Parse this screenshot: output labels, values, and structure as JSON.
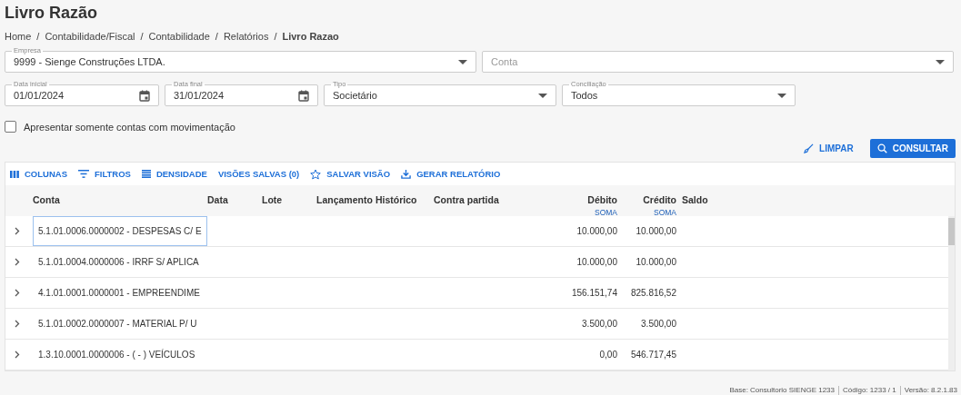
{
  "page_title": "Livro Razão",
  "breadcrumb": {
    "separator": "/",
    "items": [
      {
        "label": "Home",
        "current": false
      },
      {
        "label": "Contabilidade/Fiscal",
        "current": false
      },
      {
        "label": "Contabilidade",
        "current": false
      },
      {
        "label": "Relatórios",
        "current": false
      },
      {
        "label": "Livro Razao",
        "current": true
      }
    ]
  },
  "filters": {
    "empresa": {
      "label": "Empresa",
      "value": "9999 - Sienge Construções LTDA."
    },
    "conta": {
      "placeholder": "Conta"
    },
    "data_inicial": {
      "label": "Data inicial",
      "value": "01/01/2024"
    },
    "data_final": {
      "label": "Data final",
      "value": "31/01/2024"
    },
    "tipo": {
      "label": "Tipo",
      "value": "Societário"
    },
    "conciliacao": {
      "label": "Conciliação",
      "value": "Todos"
    },
    "only_moved": {
      "label": "Apresentar somente contas com movimentação",
      "checked": false
    }
  },
  "actions": {
    "clear": "LIMPAR",
    "search": "CONSULTAR"
  },
  "toolbar": [
    {
      "kind": "columns",
      "label": "COLUNAS"
    },
    {
      "kind": "filters",
      "label": "FILTROS"
    },
    {
      "kind": "density",
      "label": "DENSIDADE"
    },
    {
      "kind": "views",
      "label": "VISÕES SALVAS (0)"
    },
    {
      "kind": "save",
      "label": "SALVAR VISÃO"
    },
    {
      "kind": "export",
      "label": "GERAR RELATÓRIO"
    }
  ],
  "table": {
    "columns": [
      {
        "label": "Conta"
      },
      {
        "label": "Data"
      },
      {
        "label": "Lote"
      },
      {
        "label": "Lançamento"
      },
      {
        "label": "Histórico"
      },
      {
        "label": "Contra partida"
      },
      {
        "label": "Débito",
        "aggregate": "SOMA"
      },
      {
        "label": "Crédito",
        "aggregate": "SOMA"
      },
      {
        "label": "Saldo"
      }
    ],
    "rows": [
      {
        "conta": "5.1.01.0006.0000002 - DESPESAS C/ E",
        "debito": "10.000,00",
        "credito": "10.000,00",
        "selected": true
      },
      {
        "conta": "5.1.01.0004.0000006 - IRRF S/ APLICA",
        "debito": "10.000,00",
        "credito": "10.000,00",
        "selected": false
      },
      {
        "conta": "4.1.01.0001.0000001 - EMPREENDIME",
        "debito": "156.151,74",
        "credito": "825.816,52",
        "selected": false
      },
      {
        "conta": "5.1.01.0002.0000007 - MATERIAL P/ U",
        "debito": "3.500,00",
        "credito": "3.500,00",
        "selected": false
      },
      {
        "conta": "1.3.10.0001.0000006 - ( - ) VEÍCULOS",
        "debito": "0,00",
        "credito": "546.717,45",
        "selected": false
      }
    ]
  },
  "status_bar": [
    "Base: Consultorio SIENGE 1233",
    "Código: 1233 / 1",
    "Versão: 8.2.1.83"
  ]
}
